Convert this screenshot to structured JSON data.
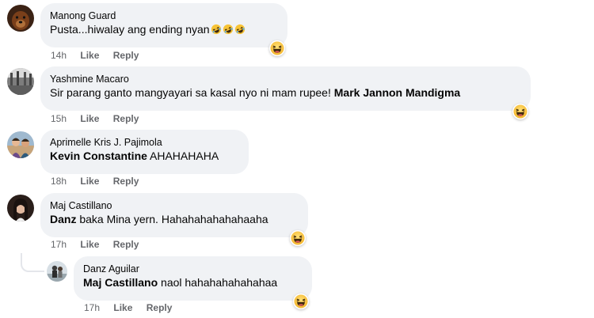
{
  "comments": [
    {
      "author": "Manong Guard",
      "text": "Pusta...hiwalay ang ending nyan",
      "time": "14h",
      "like": "Like",
      "reply": "Reply"
    },
    {
      "author": "Yashmine Macaro",
      "text": "Sir parang ganto mangyayari sa kasal nyo ni mam rupee! ",
      "tag": "Mark Jannon Mandigma",
      "time": "15h",
      "like": "Like",
      "reply": "Reply"
    },
    {
      "author": "Aprimelle Kris J. Pajimola",
      "tag": "Kevin Constantine",
      "text": " AHAHAHAHA",
      "time": "18h",
      "like": "Like",
      "reply": "Reply"
    },
    {
      "author": "Maj Castillano",
      "tag": "Danz",
      "text": " baka Mina yern. Hahahahahahahaaha",
      "time": "17h",
      "like": "Like",
      "reply": "Reply"
    },
    {
      "author": "Danz Aguilar",
      "tag": "Maj Castillano",
      "text": " naol hahahahahahahaa",
      "time": "17h",
      "like": "Like",
      "reply": "Reply"
    }
  ],
  "icons": {
    "reaction": "haha-reaction-icon",
    "inline_emoji": "rolling-on-floor-laughing-emoji"
  },
  "colors": {
    "bubble_bg": "#f0f2f5",
    "meta_text": "#65676b",
    "name_text": "#050505",
    "emoji_yellow": "#f7b125"
  }
}
